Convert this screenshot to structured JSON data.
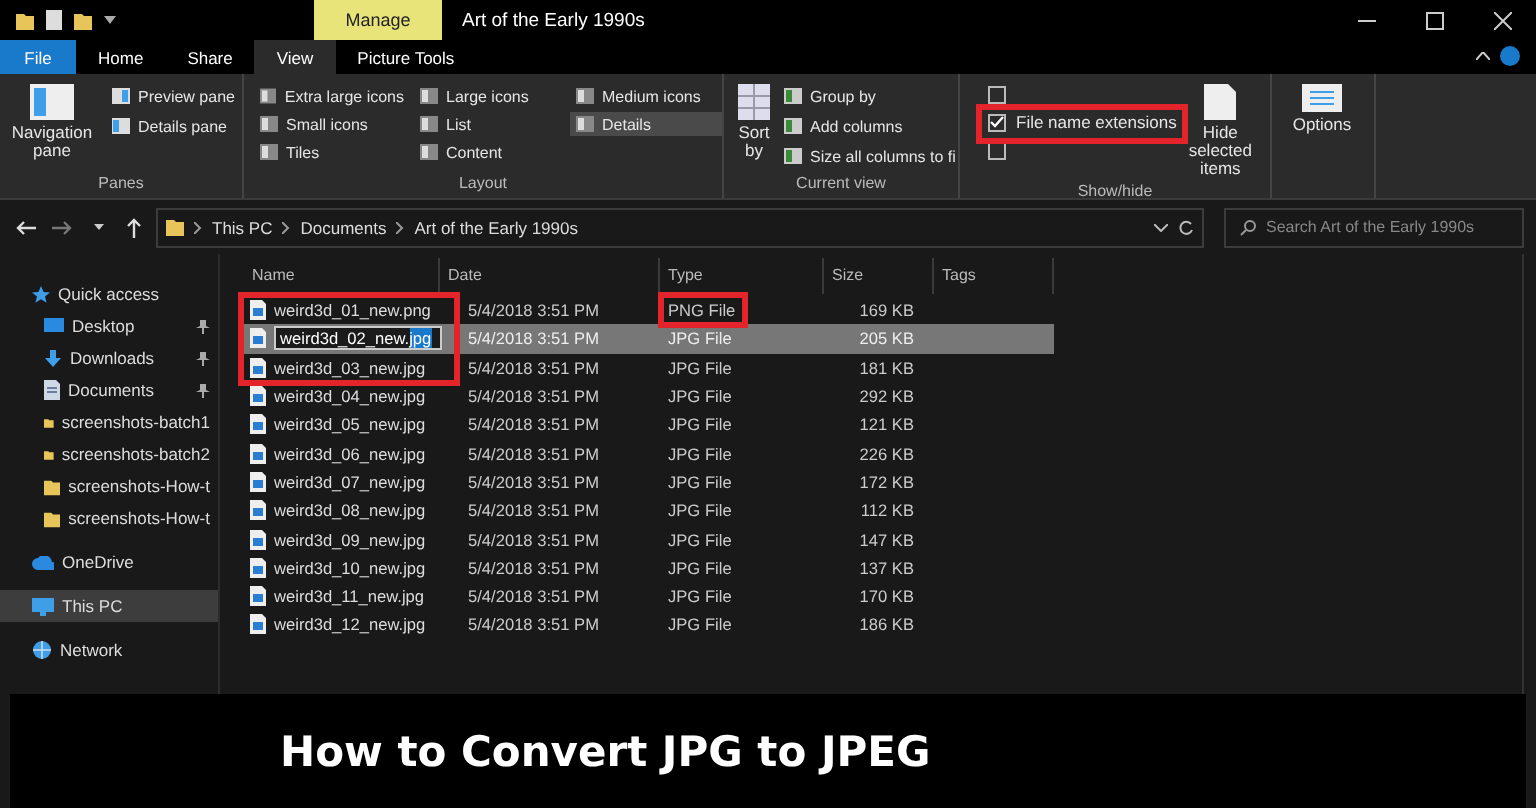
{
  "title_bar": {
    "context_tab": "Manage",
    "title": "Art of the Early 1990s"
  },
  "ribbon_tabs": [
    {
      "label": "File",
      "kind": "file",
      "selected": false
    },
    {
      "label": "Home",
      "kind": "tab",
      "selected": false
    },
    {
      "label": "Share",
      "kind": "tab",
      "selected": false
    },
    {
      "label": "View",
      "kind": "tab",
      "selected": true
    },
    {
      "label": "Picture Tools",
      "kind": "tab",
      "selected": false
    }
  ],
  "ribbon": {
    "panes": {
      "label": "Panes",
      "navigation_pane": "Navigation pane",
      "items": [
        "Preview pane",
        "Details pane"
      ]
    },
    "layout": {
      "label": "Layout",
      "options": [
        {
          "label": "Extra large icons",
          "selected": false
        },
        {
          "label": "Small icons",
          "selected": false
        },
        {
          "label": "Tiles",
          "selected": false
        },
        {
          "label": "Large icons",
          "selected": false
        },
        {
          "label": "List",
          "selected": false
        },
        {
          "label": "Content",
          "selected": false
        },
        {
          "label": "Medium icons",
          "selected": false
        },
        {
          "label": "Details",
          "selected": true
        }
      ]
    },
    "current_view": {
      "label": "Current view",
      "sort_by": "Sort by",
      "items": [
        "Group by",
        "Add columns",
        "Size all columns to fi"
      ]
    },
    "show_hide": {
      "label": "Show/hide",
      "highlighted": true,
      "checkboxes": [
        {
          "checked": false
        },
        {
          "label": "File name extensions",
          "checked": true
        },
        {
          "checked": false
        }
      ],
      "hide_selected": "Hide selected items"
    },
    "options": {
      "label": "Options"
    }
  },
  "address_bar": {
    "path": [
      "This PC",
      "Documents",
      "Art of the Early 1990s"
    ],
    "search_placeholder": "Search Art of the Early 1990s"
  },
  "sidebar": {
    "items": [
      {
        "label": "Quick access",
        "kind": "star",
        "pinned": false,
        "selected": false
      },
      {
        "label": "Desktop",
        "kind": "desktop",
        "pinned": true,
        "selected": false
      },
      {
        "label": "Downloads",
        "kind": "download",
        "pinned": true,
        "selected": false
      },
      {
        "label": "Documents",
        "kind": "document",
        "pinned": true,
        "selected": false
      },
      {
        "label": "screenshots-batch1",
        "kind": "folder",
        "pinned": false,
        "selected": false
      },
      {
        "label": "screenshots-batch2",
        "kind": "folder",
        "pinned": false,
        "selected": false
      },
      {
        "label": "screenshots-How-t",
        "kind": "folder",
        "pinned": false,
        "selected": false
      },
      {
        "label": "screenshots-How-t",
        "kind": "folder",
        "pinned": false,
        "selected": false
      },
      {
        "label": "OneDrive",
        "kind": "cloud",
        "pinned": false,
        "selected": false
      },
      {
        "label": "This PC",
        "kind": "pc",
        "pinned": false,
        "selected": true
      },
      {
        "label": "Network",
        "kind": "network",
        "pinned": false,
        "selected": false
      }
    ]
  },
  "file_list": {
    "columns": [
      "Name",
      "Date",
      "Type",
      "Size",
      "Tags"
    ],
    "rows": [
      {
        "name": "weird3d_01_new.png",
        "date": "5/4/2018 3:51 PM",
        "type": "PNG File",
        "size": "169 KB",
        "selected": false,
        "name_marked": true,
        "type_marked": true
      },
      {
        "name": "weird3d_02_new.",
        "name_selection": "jpg",
        "date": "5/4/2018 3:51 PM",
        "type": "JPG File",
        "size": "205 KB",
        "selected": true,
        "name_marked": true,
        "type_marked": false
      },
      {
        "name": "weird3d_03_new.jpg",
        "date": "5/4/2018 3:51 PM",
        "type": "JPG File",
        "size": "181 KB",
        "selected": false,
        "name_marked": true,
        "type_marked": false
      },
      {
        "name": "weird3d_04_new.jpg",
        "date": "5/4/2018 3:51 PM",
        "type": "JPG File",
        "size": "292 KB",
        "selected": false,
        "name_marked": false,
        "type_marked": false
      },
      {
        "name": "weird3d_05_new.jpg",
        "date": "5/4/2018 3:51 PM",
        "type": "JPG File",
        "size": "121 KB",
        "selected": false,
        "name_marked": false,
        "type_marked": false
      },
      {
        "name": "weird3d_06_new.jpg",
        "date": "5/4/2018 3:51 PM",
        "type": "JPG File",
        "size": "226 KB",
        "selected": false,
        "name_marked": false,
        "type_marked": false
      },
      {
        "name": "weird3d_07_new.jpg",
        "date": "5/4/2018 3:51 PM",
        "type": "JPG File",
        "size": "172 KB",
        "selected": false,
        "name_marked": false,
        "type_marked": false
      },
      {
        "name": "weird3d_08_new.jpg",
        "date": "5/4/2018 3:51 PM",
        "type": "JPG File",
        "size": "112 KB",
        "selected": false,
        "name_marked": false,
        "type_marked": false
      },
      {
        "name": "weird3d_09_new.jpg",
        "date": "5/4/2018 3:51 PM",
        "type": "JPG File",
        "size": "147 KB",
        "selected": false,
        "name_marked": false,
        "type_marked": false
      },
      {
        "name": "weird3d_10_new.jpg",
        "date": "5/4/2018 3:51 PM",
        "type": "JPG File",
        "size": "137 KB",
        "selected": false,
        "name_marked": false,
        "type_marked": false
      },
      {
        "name": "weird3d_11_new.jpg",
        "date": "5/4/2018 3:51 PM",
        "type": "JPG File",
        "size": "170 KB",
        "selected": false,
        "name_marked": false,
        "type_marked": false
      },
      {
        "name": "weird3d_12_new.jpg",
        "date": "5/4/2018 3:51 PM",
        "type": "JPG File",
        "size": "186 KB",
        "selected": false,
        "name_marked": false,
        "type_marked": false
      }
    ]
  },
  "caption": "How to Convert JPG to JPEG"
}
